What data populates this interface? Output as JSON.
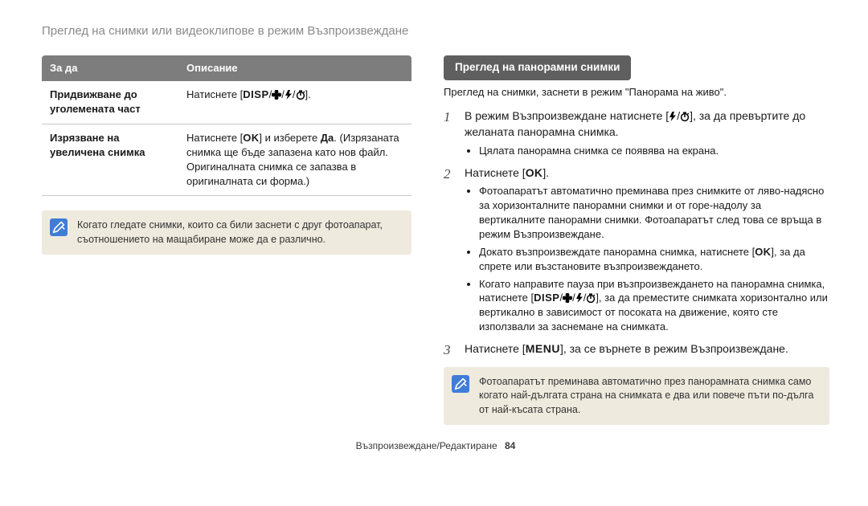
{
  "page": {
    "section_title": "Преглед на снимки или видеоклипове в режим Възпроизвеждане",
    "footer_text": "Възпроизвеждане/Редактиране",
    "footer_page": "84"
  },
  "table": {
    "headers": {
      "action": "За да",
      "desc": "Описание"
    },
    "rows": [
      {
        "action": "Придвижване до уголемената част",
        "desc_prefix": "Натиснете [",
        "disp": "DISP",
        "desc_suffix": "]."
      },
      {
        "action": "Изрязване на увеличена снимка",
        "desc_prefix": "Натиснете [",
        "ok": "OK",
        "desc_mid": "] и изберете ",
        "yes": "Да",
        "desc_tail": ". (Изрязаната снимка ще бъде запазена като нов файл. Оригиналната снимка се запазва в оригиналната си форма.)"
      }
    ]
  },
  "note_left": "Когато гледате снимки, които са били заснети с друг фотоапарат, съотношението на мащабиране може да е различно.",
  "right": {
    "badge": "Преглед на панорамни снимки",
    "intro": "Преглед на снимки, заснети в режим \"Панорама на живо\".",
    "step1": {
      "pre": "В режим Възпроизвеждане натиснете [",
      "post": "], за да превъртите до желаната панорамна снимка.",
      "bullet1": "Цялата панорамна снимка се появява на екрана."
    },
    "step2": {
      "pre": "Натиснете [",
      "ok": "OK",
      "post": "].",
      "b1": "Фотоапаратът автоматично преминава през снимките от ляво-надясно за хоризонталните панорамни снимки и от горе-надолу за вертикалните панорамни снимки. Фотоапаратът след това се връща в режим Възпроизвеждане.",
      "b2_pre": "Докато възпроизвеждате панорамна снимка, натиснете [",
      "b2_ok": "OK",
      "b2_post": "], за да спрете или възстановите възпроизвеждането.",
      "b3_pre": "Когато направите пауза при възпроизвеждането на панорамна снимка, натиснете [",
      "b3_disp": "DISP",
      "b3_post": "], за да преместите снимката хоризонтално или вертикално в зависимост от посоката на движение, която сте използвали за заснемане на снимката."
    },
    "step3": {
      "pre": "Натиснете [",
      "menu": "MENU",
      "post": "], за се върнете в режим Възпроизвеждане."
    },
    "note": "Фотоапаратът преминава автоматично през панорамната снимка само когато най-дългата страна на снимката е два или повече пъти по-дълга от най-късата страна."
  },
  "icons": {
    "flower": "macro-icon",
    "flash": "flash-icon",
    "timer": "timer-icon",
    "disp": "DISP",
    "ok": "OK",
    "menu": "MENU"
  }
}
